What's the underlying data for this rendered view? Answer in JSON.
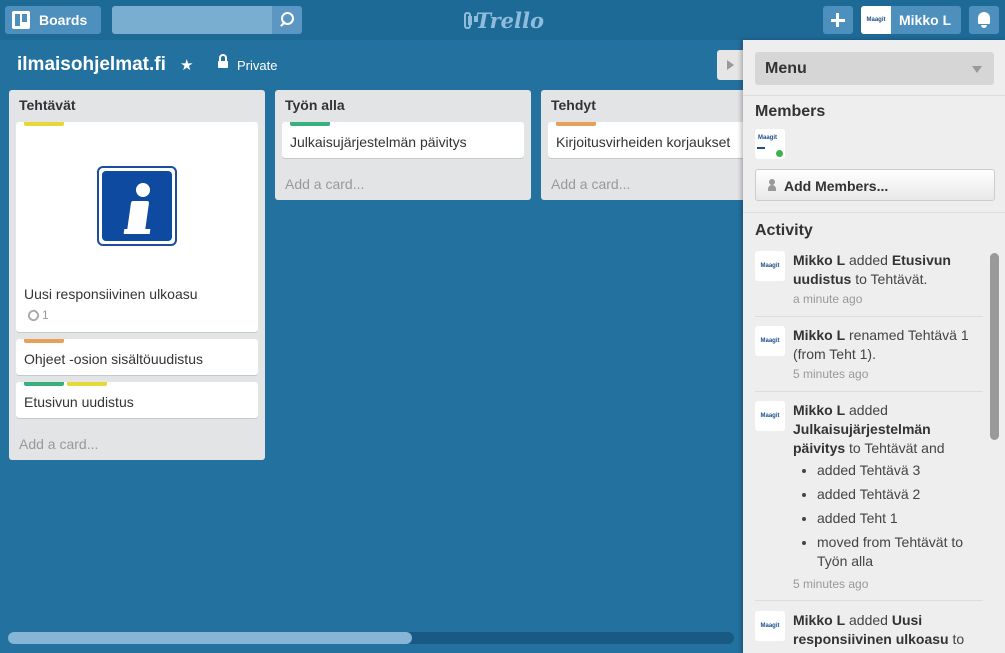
{
  "header": {
    "boards_label": "Boards",
    "search_placeholder": "",
    "logo_text": "Trello",
    "member_name": "Mikko L",
    "avatar_text": "Maagit"
  },
  "board": {
    "title": "ilmaisohjelmat.fi",
    "privacy": "Private"
  },
  "lists": [
    {
      "title": "Tehtävät",
      "cards": [
        {
          "text": "Uusi responsiivinen ulkoasu",
          "attachments": "1",
          "labels": [
            "#e5d837"
          ]
        },
        {
          "text": "Ohjeet -osion sisältöuudistus",
          "labels": [
            "#e6a05a"
          ]
        },
        {
          "text": "Etusivun uudistus",
          "labels": [
            "#37b07d",
            "#e5d837"
          ]
        }
      ],
      "add_card": "Add a card..."
    },
    {
      "title": "Työn alla",
      "cards": [
        {
          "text": "Julkaisujärjestelmän päivitys",
          "labels": [
            "#37b07d"
          ]
        }
      ],
      "add_card": "Add a card..."
    },
    {
      "title": "Tehdyt",
      "cards": [
        {
          "text": "Kirjoitusvirheiden korjaukset",
          "labels": [
            "#e6a05a"
          ]
        }
      ],
      "add_card": "Add a card..."
    }
  ],
  "sidebar": {
    "menu_title": "Menu",
    "members_title": "Members",
    "add_members_label": "Add Members...",
    "activity_title": "Activity",
    "activities": [
      {
        "user": "Mikko L",
        "a": " added ",
        "b": "Etusivun uudistus",
        "c": " to Tehtävät.",
        "time": "a minute ago"
      },
      {
        "user": "Mikko L",
        "a": " renamed Tehtävä 1 (from Teht 1).",
        "time": "5 minutes ago"
      },
      {
        "user": "Mikko L",
        "a": " added ",
        "b": "Julkaisujärjestelmän päivitys",
        "c": " to Tehtävät and",
        "bullets": [
          "added Tehtävä 3",
          "added Tehtävä 2",
          "added Teht 1",
          "moved from Tehtävät to Työn alla"
        ],
        "time": "5 minutes ago"
      },
      {
        "user": "Mikko L",
        "a": " added ",
        "b": "Uusi responsiivinen ulkoasu",
        "c": " to Tehtävät and attached"
      }
    ]
  }
}
